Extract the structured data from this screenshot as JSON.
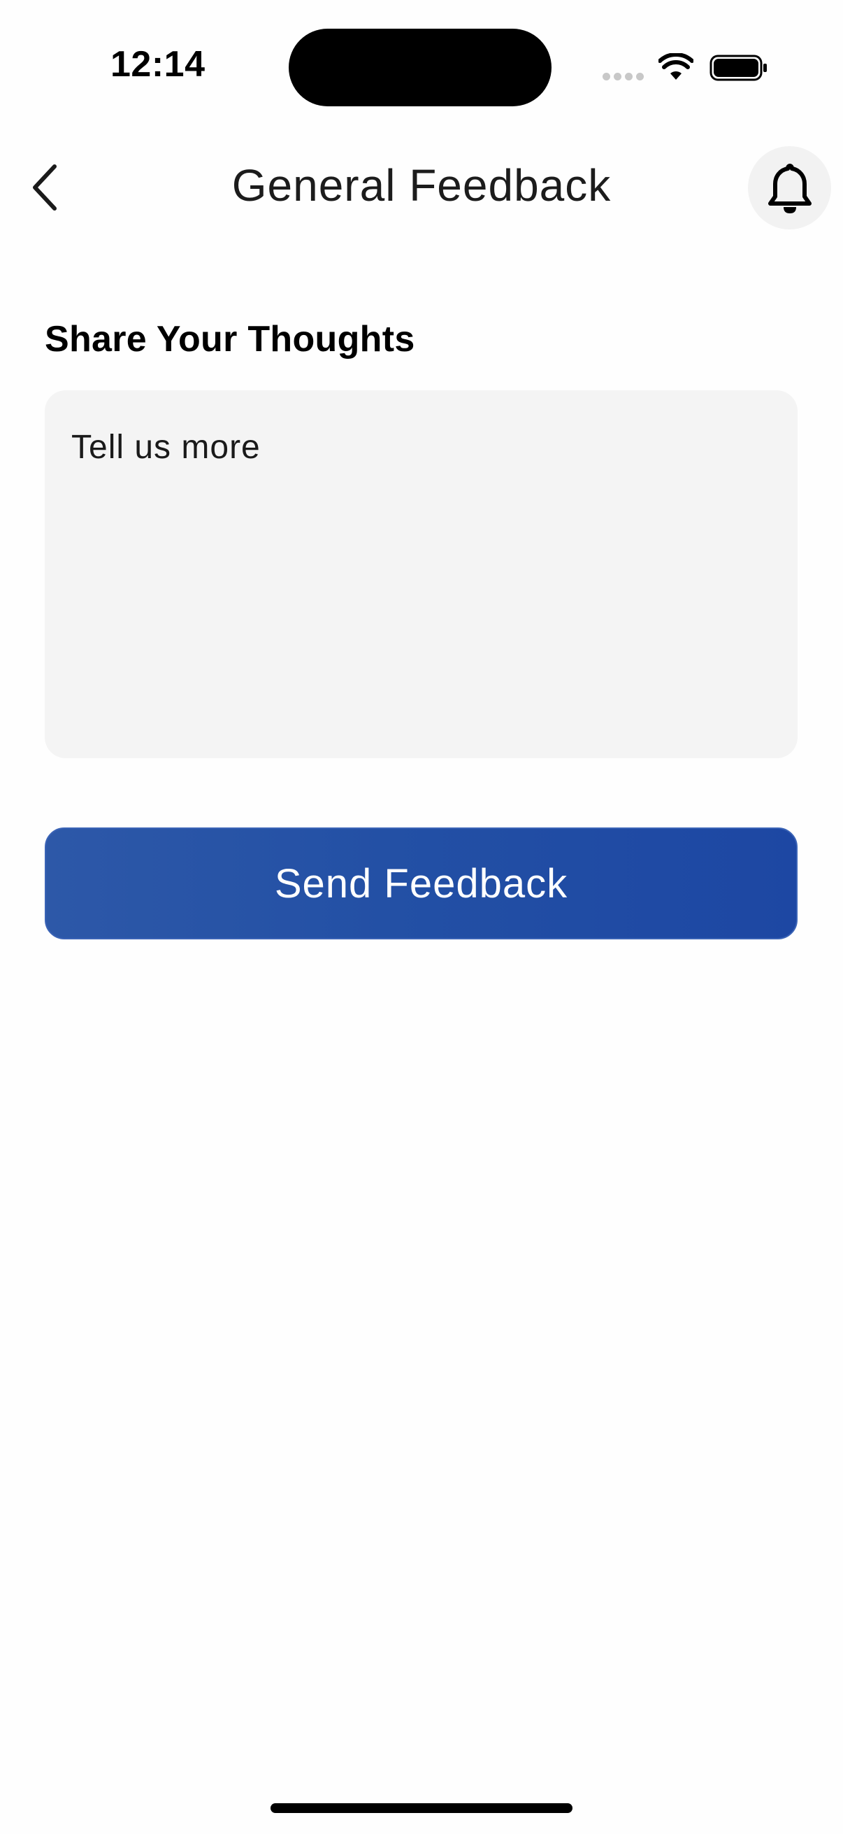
{
  "status_bar": {
    "time": "12:14"
  },
  "header": {
    "title": "General Feedback",
    "back_icon": "chevron-left-icon",
    "notification_icon": "bell-icon"
  },
  "feedback_form": {
    "section_label": "Share Your Thoughts",
    "textarea_value": "",
    "textarea_placeholder": "Tell us more",
    "submit_label": "Send Feedback"
  },
  "colors": {
    "accent": "#2350a5",
    "input_background": "#f4f4f4",
    "bell_button_background": "#f2f2f2"
  }
}
